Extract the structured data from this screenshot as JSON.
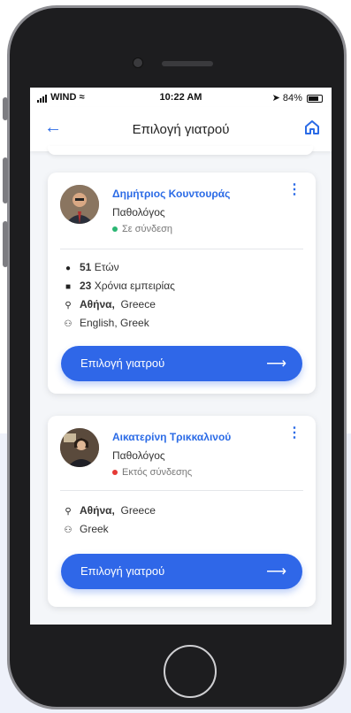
{
  "status_bar": {
    "carrier": "WIND",
    "time": "10:22 AM",
    "battery": "84%"
  },
  "header": {
    "title": "Επιλογή γιατρού"
  },
  "doctors": [
    {
      "name": "Δημήτριος Κουντουράς",
      "specialty": "Παθολόγος",
      "status": "Σε σύνδεση",
      "status_color": "#2bb673",
      "age_value": "51",
      "age_label": "Ετών",
      "exp_value": "23",
      "exp_label": "Χρόνια εμπειρίας",
      "city": "Αθήνα,",
      "country": "Greece",
      "languages": "English, Greek",
      "button": "Επιλογή γιατρού"
    },
    {
      "name": "Αικατερίνη Τρικκαλινού",
      "specialty": "Παθολόγος",
      "status": "Εκτός σύνδεσης",
      "status_color": "#e53935",
      "city": "Αθήνα,",
      "country": "Greece",
      "languages": "Greek",
      "button": "Επιλογή γιατρού"
    }
  ],
  "icons": {
    "back": "arrow-left-icon",
    "home": "home-icon",
    "more": "kebab-icon",
    "person": "person-icon",
    "briefcase": "briefcase-icon",
    "location": "location-pin-icon",
    "language": "language-icon",
    "arrow": "arrow-right-icon"
  },
  "colors": {
    "accent": "#2f67e8",
    "online": "#2bb673",
    "offline": "#e53935"
  }
}
